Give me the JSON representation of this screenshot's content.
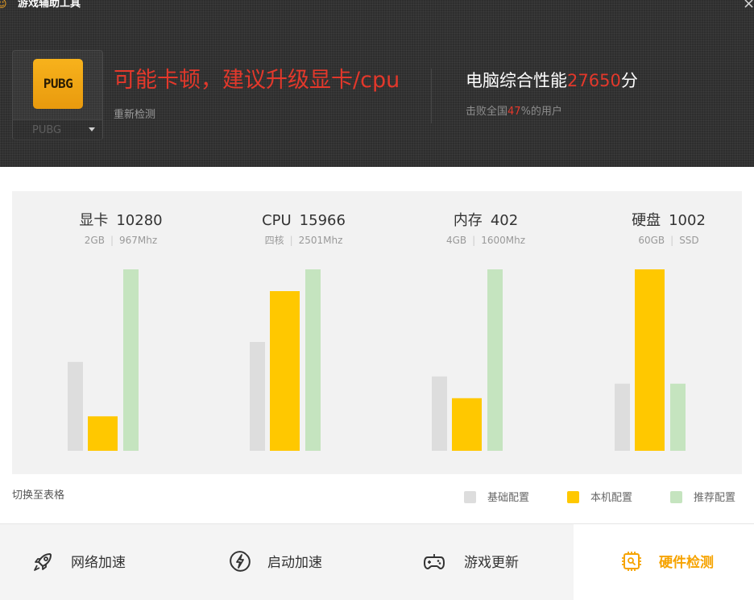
{
  "window": {
    "title": "游戏辅助工具",
    "close_symbol": "×"
  },
  "game": {
    "logo_text": "PUBG",
    "selected": "PUBG"
  },
  "status": {
    "message": "可能卡顿，建议升级显卡/cpu",
    "recheck_label": "重新检测"
  },
  "score": {
    "prefix": "电脑综合性能",
    "value": "27650",
    "suffix": "分",
    "beat_prefix": "击败全国",
    "beat_percent": "47",
    "beat_suffix": "%的用户"
  },
  "chart_data": {
    "type": "bar",
    "categories": [
      "显卡",
      "CPU",
      "内存",
      "硬盘"
    ],
    "scores": [
      "10280",
      "15966",
      "402",
      "1002"
    ],
    "subs": [
      [
        "2GB",
        "967Mhz"
      ],
      [
        "四核",
        "2501Mhz"
      ],
      [
        "4GB",
        "1600Mhz"
      ],
      [
        "60GB",
        "SSD"
      ]
    ],
    "series": [
      {
        "name": "基础配置",
        "color": "#dddddd",
        "values": [
          0.49,
          0.6,
          0.41,
          0.37
        ]
      },
      {
        "name": "本机配置",
        "color": "#ffc800",
        "values": [
          0.19,
          0.88,
          0.29,
          1.0
        ]
      },
      {
        "name": "推荐配置",
        "color": "#c5e4bf",
        "values": [
          1.0,
          1.0,
          1.0,
          0.37
        ]
      }
    ],
    "ylim": [
      0,
      1
    ],
    "grid": false,
    "legend": "bottom-right"
  },
  "chart_footer": {
    "switch_label": "切换至表格"
  },
  "nav": {
    "items": [
      {
        "label": "网络加速",
        "icon": "rocket-icon"
      },
      {
        "label": "启动加速",
        "icon": "lightning-icon"
      },
      {
        "label": "游戏更新",
        "icon": "gamepad-icon"
      },
      {
        "label": "硬件检测",
        "icon": "chip-icon"
      }
    ],
    "active_index": 3,
    "active_color": "#f6a300"
  }
}
